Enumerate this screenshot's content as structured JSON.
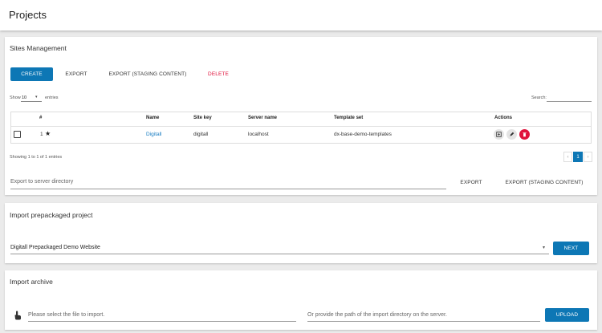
{
  "page": {
    "title": "Projects"
  },
  "sites": {
    "title": "Sites Management",
    "buttons": {
      "create": "CREATE",
      "export": "EXPORT",
      "export_staging": "EXPORT (STAGING CONTENT)",
      "delete": "DELETE"
    },
    "length": {
      "show": "Show",
      "value": "10",
      "entries": "entries"
    },
    "search_label": "Search:",
    "columns": [
      "#",
      "Name",
      "Site key",
      "Server name",
      "Template set",
      "Actions"
    ],
    "rows": [
      {
        "index": "1",
        "name": "Digitall",
        "site_key": "digitall",
        "server": "localhost",
        "template": "dx-base-demo-templates"
      }
    ],
    "info": "Showing 1 to 1 of 1 entries",
    "pagination": {
      "prev": "‹",
      "page": "1",
      "next": "›"
    },
    "export_dir_placeholder": "Export to server directory",
    "export_dir_button": "EXPORT",
    "export_dir_staging_button": "EXPORT (STAGING CONTENT)"
  },
  "import_prepackaged": {
    "title": "Import prepackaged project",
    "selected": "Digitall Prepackaged Demo Website",
    "next": "NEXT"
  },
  "import_archive": {
    "title": "Import archive",
    "file_placeholder": "Please select the file to import.",
    "path_placeholder": "Or provide the path of the import directory on the server.",
    "upload": "UPLOAD"
  },
  "colors": {
    "primary": "#0d77b5",
    "danger": "#e0123b",
    "background": "#ebebeb"
  }
}
